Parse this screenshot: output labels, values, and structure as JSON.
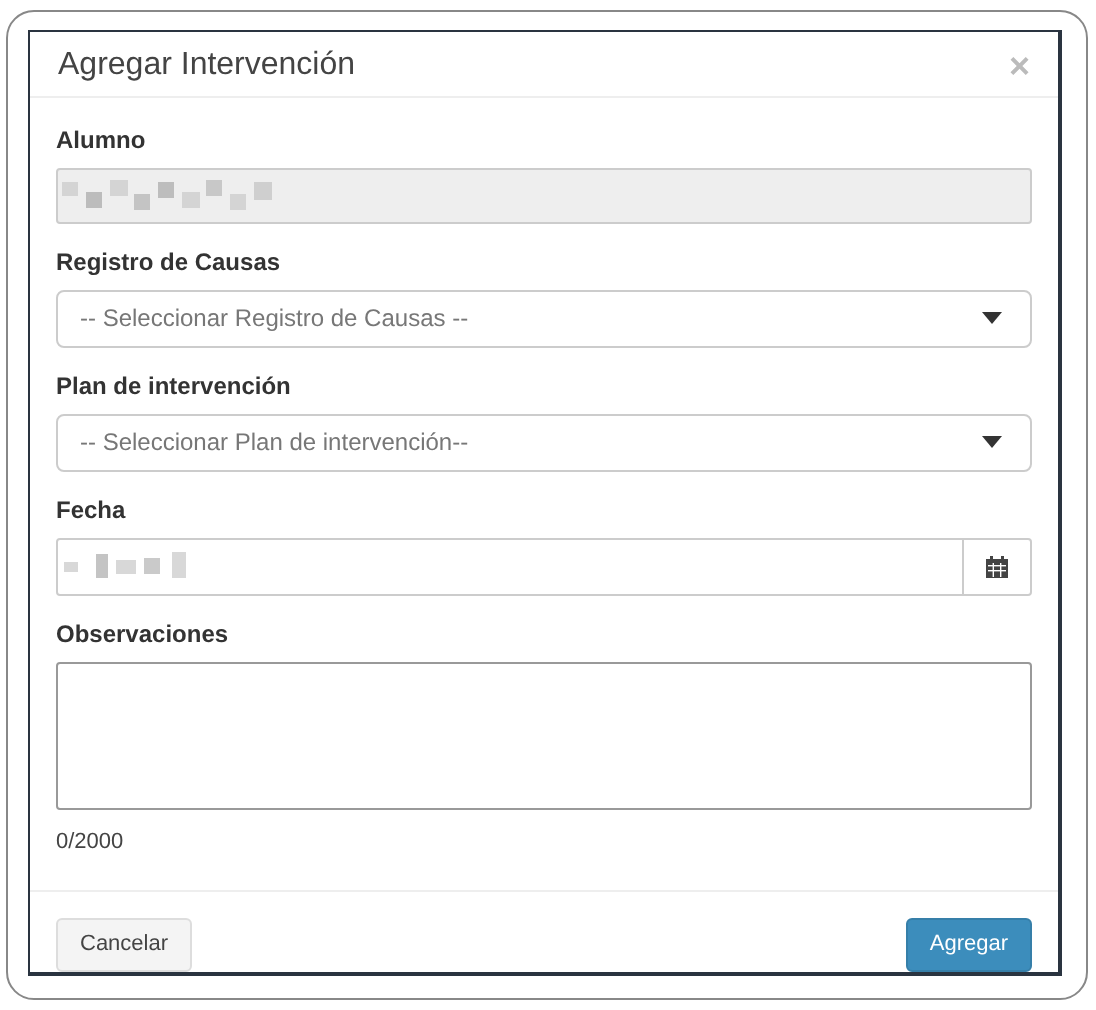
{
  "dialog": {
    "title": "Agregar Intervención",
    "close": "×"
  },
  "fields": [
    {
      "kind": "readonly",
      "label": "Alumno"
    },
    {
      "kind": "select",
      "label": "Registro de Causas",
      "placeholder": "-- Seleccionar Registro de Causas --"
    },
    {
      "kind": "select",
      "label": "Plan de intervención",
      "placeholder": "-- Seleccionar Plan de intervención--"
    },
    {
      "kind": "date",
      "label": "Fecha"
    },
    {
      "kind": "textarea",
      "label": "Observaciones",
      "counter": "0/2000"
    }
  ],
  "buttons": [
    {
      "kind": "secondary",
      "label": "Cancelar"
    },
    {
      "kind": "primary",
      "label": "Agregar"
    }
  ]
}
